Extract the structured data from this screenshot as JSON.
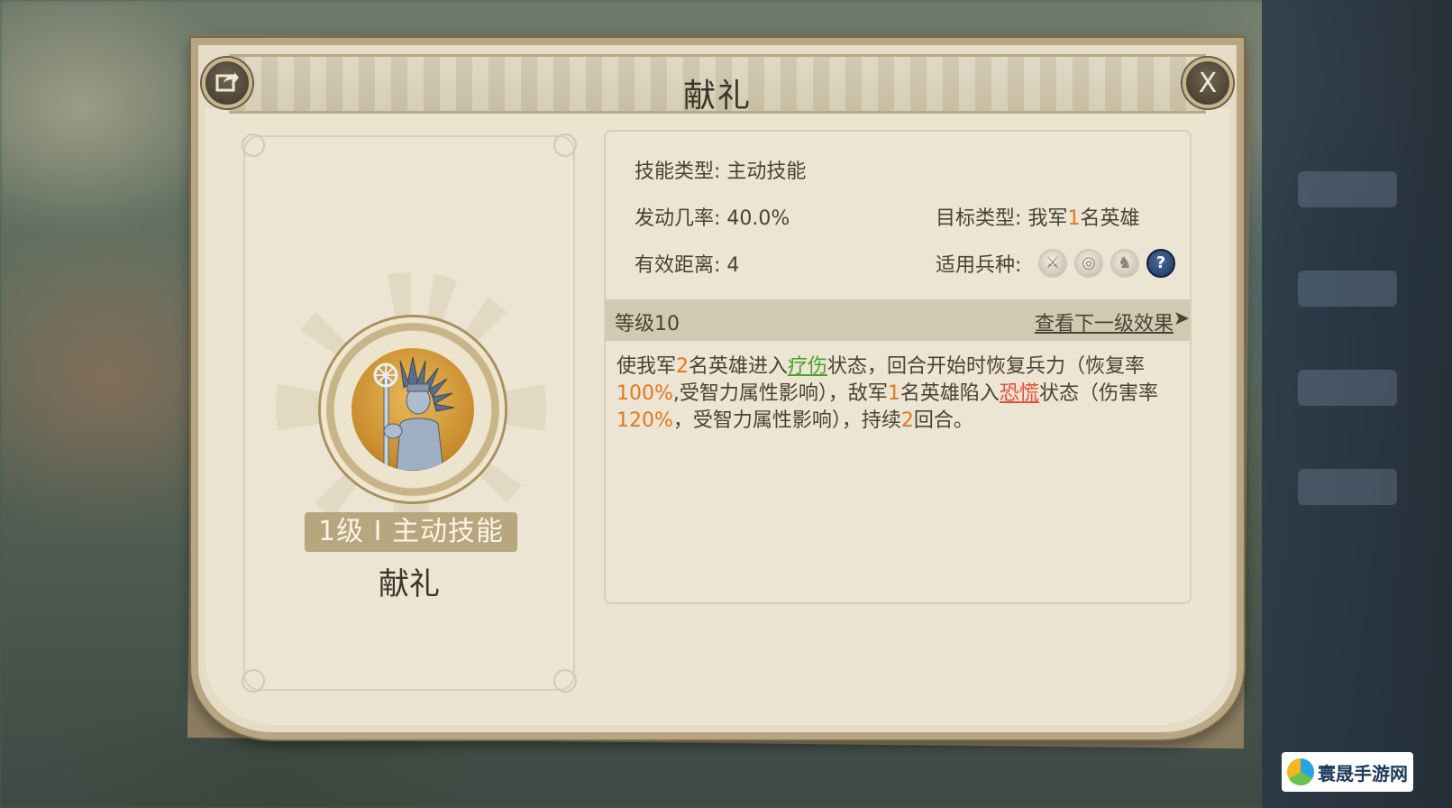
{
  "dialog": {
    "title": "献礼",
    "close_label": "X"
  },
  "skill": {
    "badge": "1级 I 主动技能",
    "name": "献礼",
    "icon": "statue-figure-icon"
  },
  "info": {
    "type_label": "技能类型:",
    "type_value": "主动技能",
    "rate_label": "发动几率:",
    "rate_value": "40.0%",
    "target_label": "目标类型:",
    "target_prefix": "我军",
    "target_number": "1",
    "target_suffix": "名英雄",
    "range_label": "有效距离:",
    "range_value": "4",
    "troops_label": "适用兵种:",
    "troop_icons": [
      "sword-icon",
      "target-icon",
      "horse-icon",
      "question-icon"
    ]
  },
  "level": {
    "label": "等级10",
    "next_link": "查看下一级效果"
  },
  "description": {
    "p1": "使我军",
    "n1": "2",
    "p2": "名英雄进入",
    "s1": "疗伤",
    "p3": "状态，回合开始时恢复兵力（恢复率",
    "n2": "100%",
    "p4": ",受智力属性影响），敌军",
    "n3": "1",
    "p5": "名英雄陷入",
    "s2": "恐慌",
    "p6": "状态（伤害率",
    "n4": "120%",
    "p7": "，受智力属性影响），持续",
    "n5": "2",
    "p8": "回合。"
  },
  "watermark": {
    "text": "寰晟手游网"
  },
  "colors": {
    "highlight_number": "#e07a1e",
    "status_heal": "#4aa02e",
    "status_panic": "#e84c3c"
  }
}
